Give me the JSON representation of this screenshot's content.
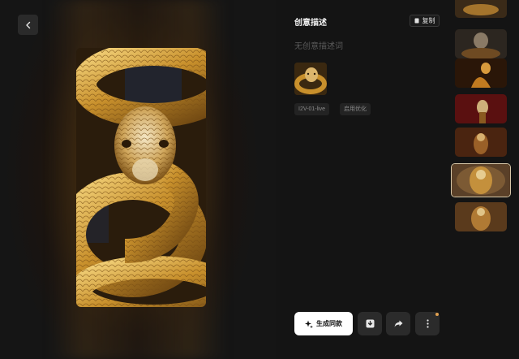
{
  "header": {
    "title": "创意描述",
    "copy_label": "复制"
  },
  "description": {
    "placeholder_text": "无创意描述词"
  },
  "tags": {
    "model": "I2V-01-live",
    "enhance": "启用优化"
  },
  "actions": {
    "make_same_label": "生成同款"
  },
  "colors": {
    "background": "#141414",
    "primary_button": "#ffffff",
    "secondary_button": "#2b2b2b",
    "notify_dot": "#e0a050",
    "selected_border": "#d8c8a8"
  },
  "icons": {
    "back": "chevron-left-icon",
    "copy": "copy-icon",
    "sparkle": "sparkle-icon",
    "download": "download-icon",
    "share": "share-icon",
    "more": "more-vertical-icon"
  },
  "gallery": {
    "thumbnail_count": 8,
    "selected_index": 6
  }
}
